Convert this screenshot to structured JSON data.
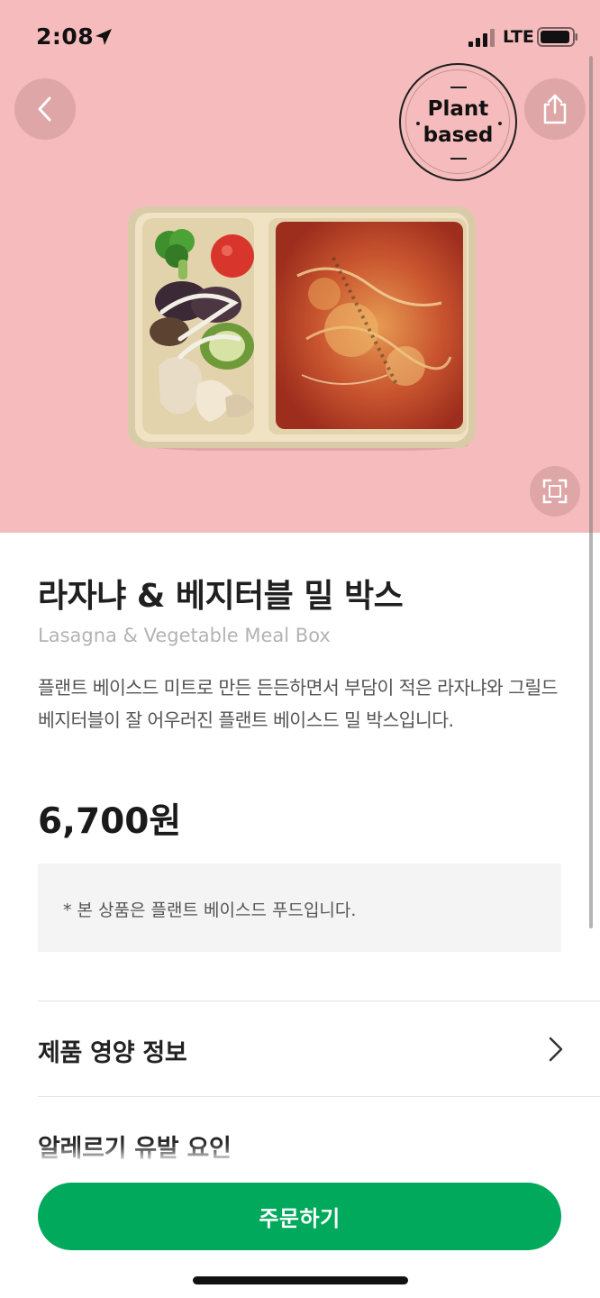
{
  "status_bar": {
    "time": "2:08",
    "network": "LTE",
    "icons": [
      "location-arrow-icon",
      "signal-icon",
      "battery-icon"
    ]
  },
  "header": {
    "back_icon": "chevron-left-icon",
    "share_icon": "share-icon",
    "fullscreen_icon": "expand-icon"
  },
  "badge": {
    "line1": "Plant",
    "line2": "based"
  },
  "product": {
    "title": "라자냐 & 베지터블 밀 박스",
    "subtitle": "Lasagna & Vegetable Meal Box",
    "description": "플랜트 베이스드 미트로 만든 든든하면서 부담이 적은 라자냐와 그릴드 베지터블이 잘 어우러진 플랜트 베이스드 밀 박스입니다.",
    "price": "6,700원",
    "notice": "* 본 상품은 플랜트 베이스드 푸드입니다."
  },
  "sections": {
    "nutrition": "제품 영양 정보",
    "allergens": "알레르기 유발 요인"
  },
  "order_button": {
    "label": "주문하기"
  },
  "colors": {
    "hero_background": "#f6bcbd",
    "accent_green": "#00a95c",
    "notice_background": "#f4f4f4"
  }
}
